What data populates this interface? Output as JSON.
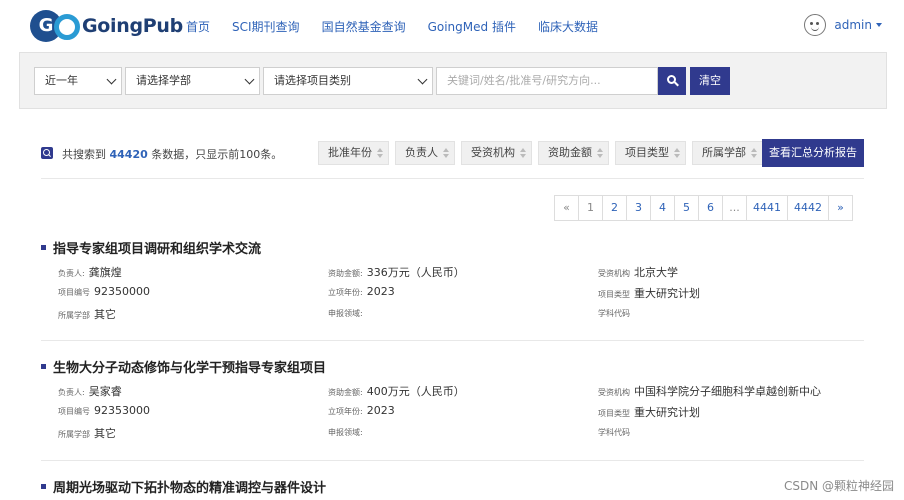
{
  "header": {
    "logo_text": "GoingPub",
    "logo_mark": "G",
    "nav": [
      "首页",
      "SCI期刊查询",
      "国自然基金查询",
      "GoingMed 插件",
      "临床大数据"
    ],
    "user": "admin"
  },
  "search": {
    "year_value": "近一年",
    "dept_value": "请选择学部",
    "type_value": "请选择项目类别",
    "keyword_placeholder": "关键词/姓名/批准号/研究方向...",
    "clear_label": "清空"
  },
  "results": {
    "prefix": "共搜索到 ",
    "count": "44420",
    "suffix": " 条数据，只显示前100条。",
    "sorts": [
      "批准年份",
      "负责人",
      "受资机构",
      "资助金额",
      "项目类型",
      "所属学部"
    ],
    "report_label": "查看汇总分析报告"
  },
  "pagination": [
    "«",
    "1",
    "2",
    "3",
    "4",
    "5",
    "6",
    "...",
    "4441",
    "4442",
    "»"
  ],
  "labels": {
    "leader": "负责人:",
    "amount": "资助金额:",
    "org": "受资机构",
    "project_no": "项目编号",
    "year": "立项年份:",
    "type": "项目类型",
    "dept": "所属学部",
    "field": "申报领域:",
    "subject_code": "学科代码"
  },
  "items": [
    {
      "title": "指导专家组项目调研和组织学术交流",
      "leader": "龚旗煌",
      "amount": "336万元（人民币）",
      "org": "北京大学",
      "project_no": "92350000",
      "year": "2023",
      "type": "重大研究计划",
      "dept": "其它",
      "field": "",
      "subject_code": ""
    },
    {
      "title": "生物大分子动态修饰与化学干预指导专家组项目",
      "leader": "吴家睿",
      "amount": "400万元（人民币）",
      "org": "中国科学院分子细胞科学卓越创新中心",
      "project_no": "92353000",
      "year": "2023",
      "type": "重大研究计划",
      "dept": "其它",
      "field": "",
      "subject_code": ""
    },
    {
      "title": "周期光场驱动下拓扑物态的精准调控与器件设计"
    }
  ],
  "watermark": "CSDN @颗粒神经园"
}
